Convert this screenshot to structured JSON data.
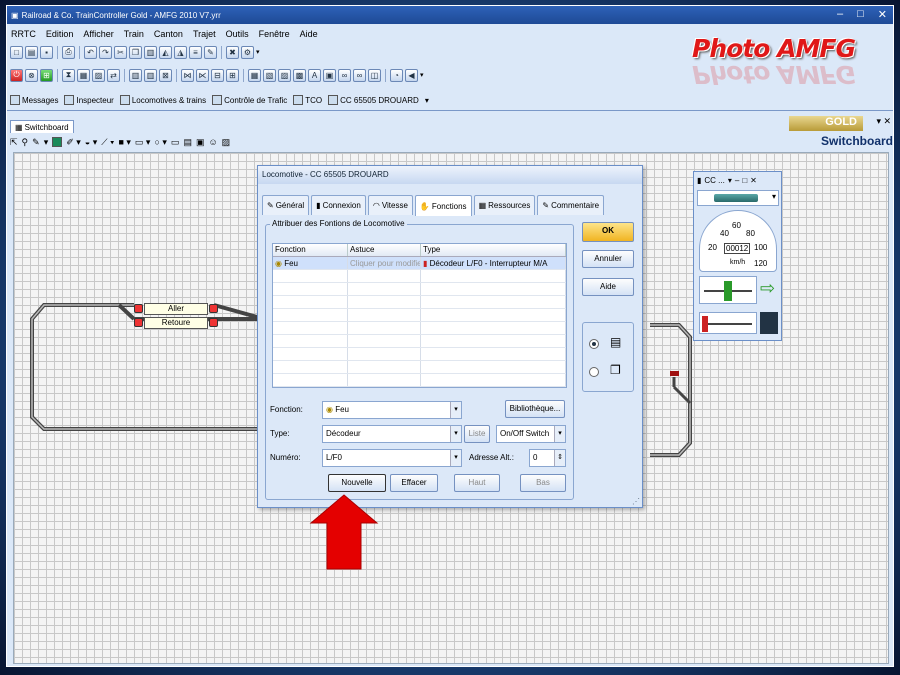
{
  "window": {
    "title": "Railroad & Co. TrainController Gold - AMFG 2010 V7.yrr",
    "controls": [
      "–",
      "□",
      "✕"
    ]
  },
  "menu": [
    "RRTC",
    "Edition",
    "Afficher",
    "Train",
    "Canton",
    "Trajet",
    "Outils",
    "Fenêtre",
    "Aide"
  ],
  "brand": {
    "logo": "Photo AMFG",
    "accent": "#e01818"
  },
  "toolbar3": [
    "Messages",
    "Inspecteur",
    "Locomotives & trains",
    "Contrôle de Trafic",
    "TCO",
    "CC 65505 DROUARD"
  ],
  "doc": {
    "tab": "Switchboard",
    "gold": "GOLD",
    "panel_title": "Switchboard"
  },
  "layout": {
    "blocks": [
      "Aller",
      "Retoure"
    ]
  },
  "dialog": {
    "title": "Locomotive - CC 65505 DROUARD",
    "tabs": [
      "Général",
      "Connexion",
      "Vitesse",
      "Fonctions",
      "Ressources",
      "Commentaire"
    ],
    "active_tab": "Fonctions",
    "group_label": "Attribuer des Fontions de Locomotive",
    "columns": [
      "Fonction",
      "Astuce",
      "Type"
    ],
    "rows": [
      {
        "fonction": "Feu",
        "astuce": "Cliquer pour modifier",
        "type": "Décodeur L/F0 - Interrupteur M/A"
      }
    ],
    "labels": {
      "fonction": "Fonction:",
      "type": "Type:",
      "numero": "Numéro:",
      "adresse": "Adresse Alt.:"
    },
    "values": {
      "fonction": "Feu",
      "type": "Décodeur",
      "numero": "L/F0",
      "mode": "On/Off Switch",
      "adresse": "0",
      "liste": "Liste"
    },
    "buttons": {
      "bibliotheque": "Bibliothèque...",
      "nouvelle": "Nouvelle",
      "effacer": "Effacer",
      "haut": "Haut",
      "bas": "Bas",
      "ok": "OK",
      "annuler": "Annuler",
      "aide": "Aide"
    }
  },
  "cab": {
    "title": "CC ...",
    "ticks": [
      "20",
      "40",
      "60",
      "80",
      "100",
      "120"
    ],
    "counter": "00012",
    "unit": "km/h"
  }
}
